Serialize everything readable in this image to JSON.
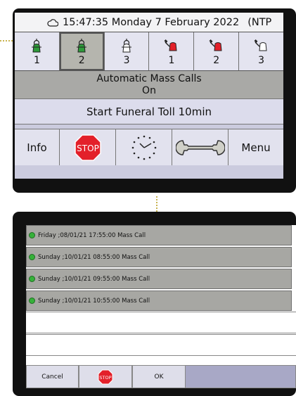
{
  "header": {
    "weather_icon": "cloud-icon",
    "datetime": "15:47:35 Monday 7 February 2022",
    "ntp": "(NTP"
  },
  "bells": [
    {
      "number": "1",
      "icon": "swinging-bell-icon",
      "color": "#2e9a3a",
      "selected": false
    },
    {
      "number": "2",
      "icon": "swinging-bell-icon",
      "color": "#2e9a3a",
      "selected": true
    },
    {
      "number": "3",
      "icon": "swinging-bell-icon",
      "color": "#ffffff",
      "selected": false
    },
    {
      "number": "1",
      "icon": "bell-with-hammer-icon",
      "color": "#e3202a",
      "selected": false
    },
    {
      "number": "2",
      "icon": "bell-with-hammer-icon",
      "color": "#e3202a",
      "selected": false
    },
    {
      "number": "3",
      "icon": "bell-with-hammer-icon",
      "color": "#ffffff",
      "selected": false
    }
  ],
  "status": {
    "line1": "Automatic Mass Calls",
    "line2": "On"
  },
  "toll": "Start Funeral Toll 10min",
  "toolbar": {
    "info_label": "Info",
    "stop_label": "STOP",
    "menu_label": "Menu"
  },
  "schedule": {
    "items": [
      "Friday ;08/01/21 17:55:00 Mass Call",
      "Sunday ;10/01/21 08:55:00 Mass Call",
      "Sunday ;10/01/21 09:55:00 Mass Call",
      "Sunday ;10/01/21 10:55:00 Mass Call"
    ],
    "status_color": "#36b13a"
  },
  "dialog": {
    "cancel_label": "Cancel",
    "stop_label": "STOP",
    "ok_label": "OK"
  },
  "colors": {
    "stop_red": "#e3202a",
    "bell_green": "#2e9a3a"
  }
}
